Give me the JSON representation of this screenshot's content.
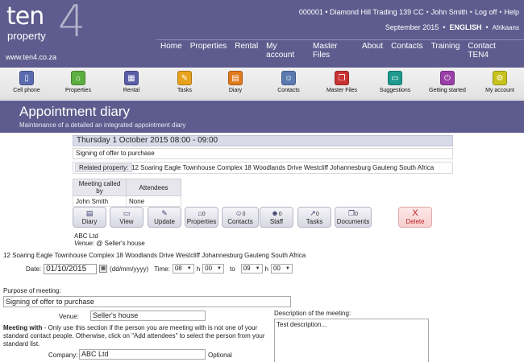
{
  "logo": {
    "main": "ten",
    "sub": "property",
    "numeral": "4"
  },
  "site_url": "www.ten4.co.za",
  "top_links": [
    "000001 • Diamond Hill Trading 139 CC",
    "John Smith",
    "Log off",
    "Help"
  ],
  "top_bar": {
    "date": "September 2015",
    "lang_active": "ENGLISH",
    "lang_other": "Afrikaans"
  },
  "main_nav": [
    "Home",
    "Properties",
    "Rental",
    "My account",
    "Master Files",
    "About",
    "Contacts",
    "Training",
    "Contact TEN4"
  ],
  "toolbar": [
    {
      "label": "Cell phone",
      "icon": "cell-phone-icon",
      "color": "#5a6ab0",
      "glyph": "▯"
    },
    {
      "label": "Properties",
      "icon": "house-icon",
      "color": "#5cae3e",
      "glyph": "⌂"
    },
    {
      "label": "Rental",
      "icon": "rental-icon",
      "color": "#5a5ea8",
      "glyph": "▦"
    },
    {
      "label": "Tasks",
      "icon": "pushpin-icon",
      "color": "#e8a21c",
      "glyph": "✎"
    },
    {
      "label": "Diary",
      "icon": "calendar-icon",
      "color": "#e07a1e",
      "glyph": "▤"
    },
    {
      "label": "Contacts",
      "icon": "person-icon",
      "color": "#5a7ab0",
      "glyph": "☺"
    },
    {
      "label": "Master Files",
      "icon": "files-icon",
      "color": "#c83232",
      "glyph": "❐"
    },
    {
      "label": "Suggestions",
      "icon": "monitor-icon",
      "color": "#1e9a8e",
      "glyph": "▭"
    },
    {
      "label": "Getting started",
      "icon": "power-icon",
      "color": "#9a3ea8",
      "glyph": "⏻"
    },
    {
      "label": "My account",
      "icon": "gear-icon",
      "color": "#c8c21e",
      "glyph": "⚙"
    }
  ],
  "page": {
    "title": "Appointment diary",
    "subtitle": "Maintenance of a detailed an integrated appointment diary"
  },
  "appointment": {
    "heading": "Thursday 1 October 2015  08:00 - 09:00",
    "subject": "Signing of offer to purchase",
    "related_label": "Related property:",
    "related_value": "12 Soaring Eagle Townhouse Complex 18 Woodlands Drive Westcliff Johannesburg Gauteng South Africa",
    "table_headers": [
      "Meeting called by",
      "Attendees"
    ],
    "table_row": [
      "John Smith",
      "None"
    ]
  },
  "actions": [
    {
      "label": "Diary",
      "icon": "diary-icon",
      "glyph": "▤",
      "count": ""
    },
    {
      "label": "View",
      "icon": "view-icon",
      "glyph": "▭",
      "count": ""
    },
    {
      "label": "Update",
      "icon": "update-icon",
      "glyph": "✎",
      "count": ""
    },
    {
      "label": "Properties",
      "icon": "house-icon",
      "glyph": "⌂",
      "count": "0"
    },
    {
      "label": "Contacts",
      "icon": "contacts-icon",
      "glyph": "☺",
      "count": "0"
    },
    {
      "label": "Staff",
      "icon": "staff-icon",
      "glyph": "☻",
      "count": "0"
    },
    {
      "label": "Tasks",
      "icon": "pushpin-icon",
      "glyph": "↗",
      "count": "0"
    },
    {
      "label": "Documents",
      "icon": "documents-icon",
      "glyph": "❐",
      "count": "0"
    },
    {
      "label": "Delete",
      "icon": "delete-icon",
      "glyph": "X",
      "count": ""
    }
  ],
  "summary": {
    "company": "ABC Ltd",
    "venue_label": "Venue:",
    "venue_value": "@ Seller's house",
    "address": "12 Soaring Eagle Townhouse Complex 18 Woodlands Drive Westcliff Johannesburg Gauteng South Africa"
  },
  "form": {
    "date_label": "Date:",
    "date_value": "01/10/2015",
    "date_format": "(dd/mm/yyyy)",
    "time_label": "Time:",
    "start_hour": "08",
    "start_min": "00",
    "h": "h",
    "to": "to",
    "end_hour": "09",
    "end_min": "00",
    "purpose_label": "Purpose of meeting:",
    "purpose_value": "Signing of offer to purchase",
    "venue_label": "Venue:",
    "venue_value": "Seller's house",
    "desc_label": "Description of the meeting:",
    "desc_value": "Test description...",
    "meetwith_bold": "Meeting with",
    "meetwith_text": " - Only use this section if the person you are meeting with is not one of your standard contact people. Otherwise, click on \"Add attendees\" to select the person from your standard list.",
    "company_label": "Company:",
    "company_value": "ABC Ltd",
    "optional": "Optional"
  }
}
